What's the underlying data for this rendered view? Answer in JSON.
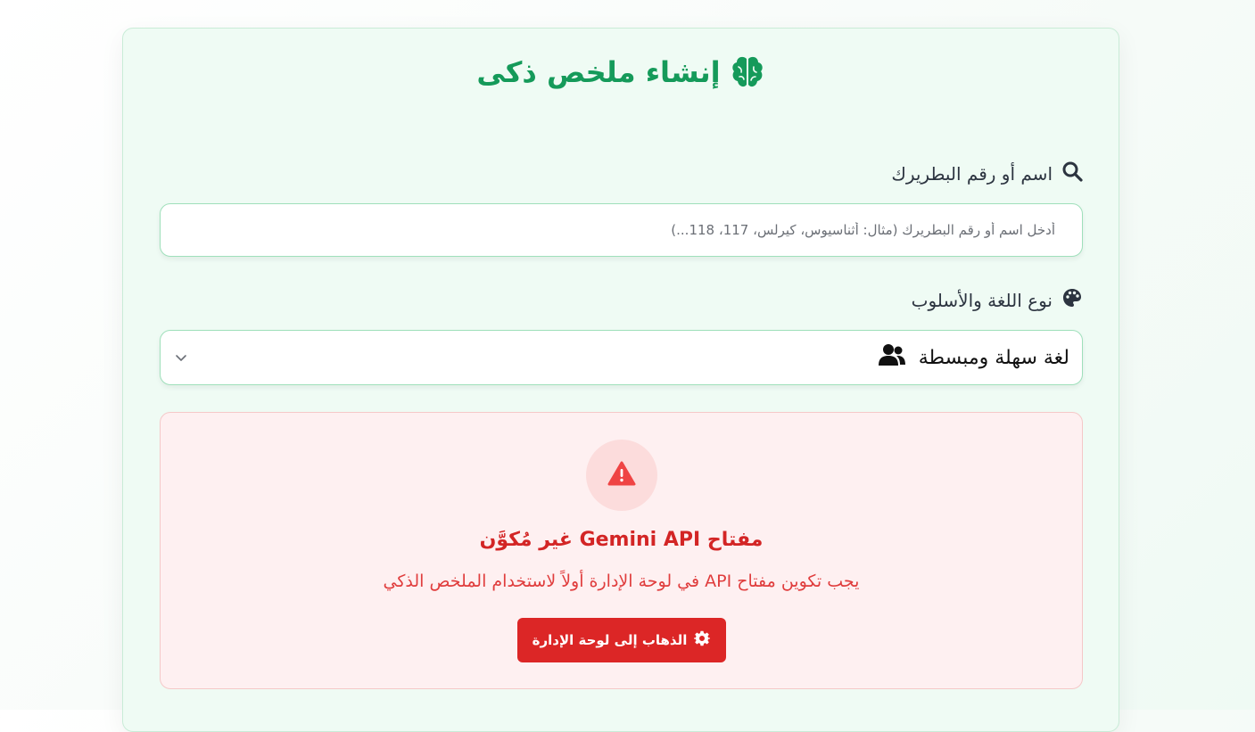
{
  "header": {
    "title": "إنشاء ملخص ذكى",
    "icon": "brain-icon",
    "color": "#159a5a"
  },
  "search_field": {
    "label": "اسم أو رقم البطريرك",
    "icon": "search-icon",
    "value": "",
    "placeholder": "أدخل اسم أو رقم البطريرك (مثال: أثناسيوس، كيرلس، 117، 118...)"
  },
  "style_field": {
    "label": "نوع اللغة والأسلوب",
    "icon": "palette-icon",
    "selected": "لغة سهلة ومبسطة",
    "selected_icon": "users-icon"
  },
  "alert": {
    "icon": "warning-icon",
    "title": "مفتاح Gemini API غير مُكوَّن",
    "message": "يجب تكوين مفتاح API في لوحة الإدارة أولاً لاستخدام الملخص الذكي",
    "button_label": "الذهاب إلى لوحة الإدارة",
    "button_icon": "gear-icon",
    "color": "#dc2626"
  }
}
